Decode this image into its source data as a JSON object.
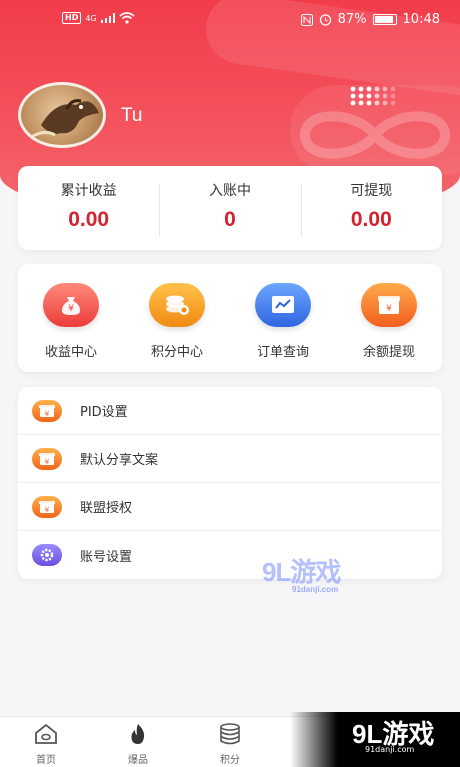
{
  "status_bar": {
    "network_badge": "HD",
    "network_type": "4G",
    "battery_percent": "87%",
    "time": "10:48"
  },
  "profile": {
    "username": "Tu"
  },
  "stats": [
    {
      "label": "累计收益",
      "value": "0.00"
    },
    {
      "label": "入账中",
      "value": "0"
    },
    {
      "label": "可提现",
      "value": "0.00"
    }
  ],
  "menu": [
    {
      "label": "收益中心",
      "icon": "money-bag-icon"
    },
    {
      "label": "积分中心",
      "icon": "coins-icon"
    },
    {
      "label": "订单查询",
      "icon": "chart-icon"
    },
    {
      "label": "余额提现",
      "icon": "wallet-icon"
    }
  ],
  "settings_list": [
    {
      "label": "PID设置",
      "icon": "yuan-box-icon"
    },
    {
      "label": "默认分享文案",
      "icon": "yuan-box-icon"
    },
    {
      "label": "联盟授权",
      "icon": "yuan-box-icon"
    },
    {
      "label": "账号设置",
      "icon": "gear-icon"
    }
  ],
  "tabbar": [
    {
      "label": "首页",
      "icon": "home-icon"
    },
    {
      "label": "爆品",
      "icon": "flame-icon"
    },
    {
      "label": "积分",
      "icon": "database-icon"
    }
  ],
  "watermark": {
    "center_text": "9L游戏",
    "center_sub": "91danji.com",
    "corner_text": "9L游戏",
    "corner_sub": "91danji.com"
  },
  "colors": {
    "brand_red": "#f23c4a",
    "value_red": "#d4222f"
  }
}
